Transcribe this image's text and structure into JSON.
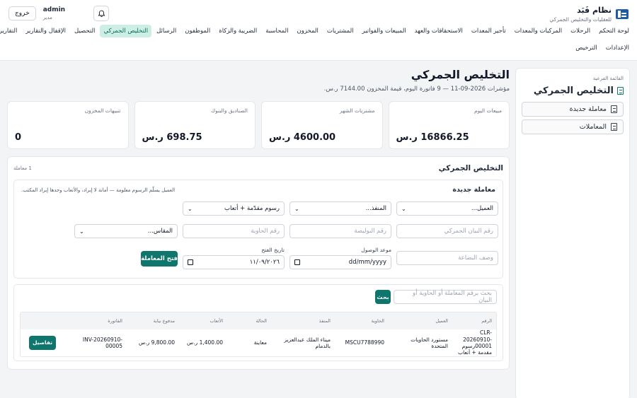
{
  "brand": {
    "name": "نظام فَبَد",
    "subtitle": "للعقليات والتخليص الجمركي",
    "logo_text": "BRAND"
  },
  "user": {
    "name": "admin",
    "role": "مدير",
    "logout_label": "خروج"
  },
  "nav": {
    "row1": [
      {
        "label": "لوحة التحكم",
        "active": false
      },
      {
        "label": "الرحلات",
        "active": false
      },
      {
        "label": "المركبات والمعدات",
        "active": false
      },
      {
        "label": "تأجير المعدات",
        "active": false
      },
      {
        "label": "الاستحقاقات والعهد",
        "active": false
      },
      {
        "label": "المبيعات والفواتير",
        "active": false
      },
      {
        "label": "المشتريات",
        "active": false
      },
      {
        "label": "المخزون",
        "active": false
      },
      {
        "label": "المحاسبة",
        "active": false
      },
      {
        "label": "الضريبة والزكاة",
        "active": false
      },
      {
        "label": "الموظفون",
        "active": false
      },
      {
        "label": "الرسائل",
        "active": false
      },
      {
        "label": "التخليص الجمركي",
        "active": true
      },
      {
        "label": "التحصيل",
        "active": false
      },
      {
        "label": "الإقفال والتقارير",
        "active": false
      },
      {
        "label": "التقارير",
        "active": false
      }
    ],
    "row2": [
      {
        "label": "الإعدادات",
        "active": false
      },
      {
        "label": "الترخيص",
        "active": false
      }
    ]
  },
  "sidebar": {
    "caption": "القائمة الفرعية",
    "title": "التخليص الجمركي",
    "items": [
      {
        "label": "معاملة جديدة"
      },
      {
        "label": "المعاملات"
      }
    ]
  },
  "page": {
    "title": "التخليص الجمركي",
    "subtitle": "مؤشرات 2026-09-11 — 9 فاتورة اليوم، قيمة المخزون 7144.00 ر.س."
  },
  "stats": [
    {
      "label": "مبيعات اليوم",
      "value": "16866.25 ر.س"
    },
    {
      "label": "مشتريات الشهر",
      "value": "4600.00 ر.س"
    },
    {
      "label": "الصناديق والبنوك",
      "value": "698.75 ر.س"
    },
    {
      "label": "تنبيهات المخزون",
      "value": "0"
    }
  ],
  "panel": {
    "title": "التخليص الجمركي",
    "count": "1 معاملة"
  },
  "form": {
    "title": "معاملة جديدة",
    "note": "العميل يسلّم الرسوم معلومة — أمانة لا إيراد، والأتعاب وحدها إيراد المكتب.",
    "client_select": "العميل...",
    "port_select": "المنفذ...",
    "type_select": "رسوم مقدّمة + أتعاب",
    "declaration_placeholder": "رقم البيان الجمركي",
    "policy_placeholder": "رقم البوليصة",
    "container_placeholder": "رقم الحاوية",
    "size_select": "المقاس...",
    "goods_placeholder": "وصف البضاعة",
    "arrival_label": "موعد الوصول",
    "arrival_value": "dd/mm/yyyy",
    "open_date_label": "تاريخ الفتح",
    "open_date_value": "١١/٠٩/٢٠٢٦",
    "submit_label": "فتح المعاملة"
  },
  "search": {
    "placeholder": "بحث برقم المعاملة أو الحاوية أو البيان",
    "button_label": "بحث"
  },
  "table": {
    "headers": [
      "الرقم",
      "العميل",
      "الحاوية",
      "المنفذ",
      "الحالة",
      "الأتعاب",
      "مدفوع نيابة",
      "الفاتورة"
    ],
    "rows": [
      {
        "number": "CLR-20260910-00001رسوم مقدمة + أتعاب",
        "client": "مستورد الحاويات المتحدة",
        "container": "MSCU7788990",
        "port": "ميناء الملك عبدالعزيز بالدمام",
        "status": "معاينة",
        "fees": "1,400.00 ر.س",
        "paid_on_behalf": "9,800.00 ر.س",
        "invoice": "INV-20260910-00005",
        "action_label": "تفاصيل"
      }
    ]
  }
}
